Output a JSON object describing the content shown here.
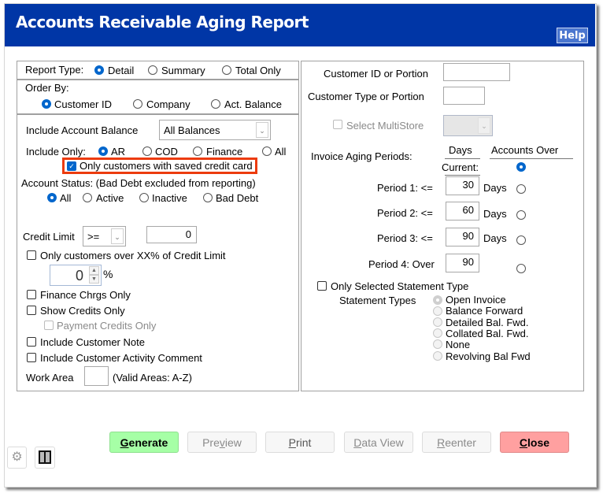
{
  "window": {
    "title": "Accounts Receivable Aging Report",
    "help_label": "Help"
  },
  "left": {
    "report_type": {
      "label": "Report Type:",
      "options": [
        {
          "label": "Detail",
          "selected": true
        },
        {
          "label": "Summary",
          "selected": false
        },
        {
          "label": "Total Only",
          "selected": false
        }
      ]
    },
    "order_by": {
      "label": "Order By:",
      "options": [
        {
          "label": "Customer ID",
          "selected": true
        },
        {
          "label": "Company",
          "selected": false
        },
        {
          "label": "Act. Balance",
          "selected": false
        }
      ]
    },
    "include_balance": {
      "label": "Include Account Balance",
      "value": "All Balances"
    },
    "include_only": {
      "label": "Include Only:",
      "options": [
        {
          "label": "AR",
          "selected": true
        },
        {
          "label": "COD",
          "selected": false
        },
        {
          "label": "Finance",
          "selected": false
        },
        {
          "label": "All",
          "selected": false
        }
      ]
    },
    "saved_credit_card": {
      "label": "Only customers with saved credit card",
      "checked": true
    },
    "account_status": {
      "label": "Account Status: (Bad Debt excluded from reporting)",
      "options": [
        {
          "label": "All",
          "selected": true
        },
        {
          "label": "Active",
          "selected": false
        },
        {
          "label": "Inactive",
          "selected": false
        },
        {
          "label": "Bad Debt",
          "selected": false
        }
      ]
    },
    "credit_limit": {
      "label": "Credit Limit",
      "operator": ">=",
      "value": "0"
    },
    "over_pct": {
      "label": "Only customers over XX% of Credit Limit",
      "checked": false,
      "value": "0",
      "unit": "%"
    },
    "finance_chrgs": {
      "label": "Finance Chrgs Only",
      "checked": false
    },
    "show_credits": {
      "label": "Show Credits Only",
      "checked": false
    },
    "payment_credits": {
      "label": "Payment Credits Only",
      "checked": false
    },
    "customer_note": {
      "label": "Include Customer Note",
      "checked": false
    },
    "activity_comment": {
      "label": "Include Customer Activity Comment",
      "checked": false
    },
    "work_area": {
      "label": "Work Area",
      "value": "",
      "hint": "(Valid Areas: A-Z)"
    }
  },
  "right": {
    "customer_id": {
      "label": "Customer ID or Portion",
      "value": ""
    },
    "customer_type": {
      "label": "Customer Type or Portion",
      "value": ""
    },
    "multistore": {
      "label": "Select MultiStore",
      "checked": false,
      "value": ""
    },
    "aging": {
      "label": "Invoice Aging Periods:",
      "days_header": "Days",
      "accounts_over_header": "Accounts Over",
      "current_label": "Current:",
      "current_selected": true,
      "periods": [
        {
          "label": "Period 1: <=",
          "value": "30",
          "unit": "Days",
          "selected": false
        },
        {
          "label": "Period 2: <=",
          "value": "60",
          "unit": "Days",
          "selected": false
        },
        {
          "label": "Period 3: <=",
          "value": "90",
          "unit": "Days",
          "selected": false
        },
        {
          "label": "Period 4: Over",
          "value": "90",
          "unit": "",
          "selected": false
        }
      ]
    },
    "selected_statement": {
      "label": "Only Selected Statement Type",
      "checked": false
    },
    "statement_types": {
      "label": "Statement Types",
      "options": [
        {
          "label": "Open Invoice",
          "selected": true
        },
        {
          "label": "Balance Forward",
          "selected": false
        },
        {
          "label": "Detailed Bal. Fwd.",
          "selected": false
        },
        {
          "label": "Collated Bal. Fwd.",
          "selected": false
        },
        {
          "label": "None",
          "selected": false
        },
        {
          "label": "Revolving Bal Fwd",
          "selected": false
        }
      ]
    }
  },
  "footer": {
    "settings_icon": "gear-icon",
    "layout_icon": "book-columns-icon",
    "buttons": {
      "generate": {
        "pre": "",
        "u": "G",
        "post": "enerate"
      },
      "preview": {
        "pre": "Pre",
        "u": "v",
        "post": "iew"
      },
      "print": {
        "pre": "",
        "u": "P",
        "post": "rint"
      },
      "data_view": {
        "pre": "",
        "u": "D",
        "post": "ata View"
      },
      "reenter": {
        "pre": "",
        "u": "R",
        "post": "eenter"
      },
      "close": {
        "pre": "",
        "u": "C",
        "post": "lose"
      }
    }
  },
  "colors": {
    "title_bar": "#0036a6",
    "radio_selected": "#0066cc",
    "generate_bg": "#a6ffa6",
    "close_bg": "#ffa0a0",
    "highlight_border": "#ec3b0e"
  }
}
